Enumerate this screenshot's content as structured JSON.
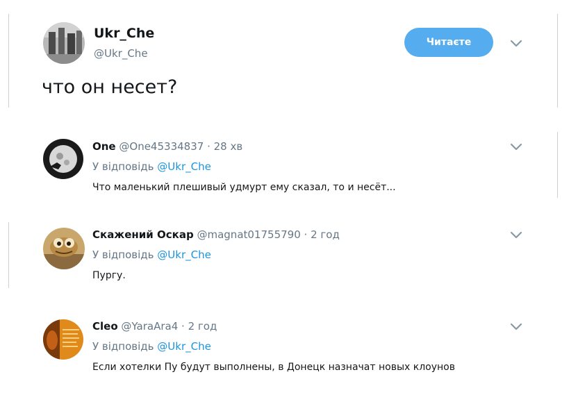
{
  "main_tweet": {
    "name": "Ukr_Che",
    "handle": "@Ukr_Che",
    "follow_label": "Читаєте",
    "text": "что он несет?",
    "chevron_icon": "chevron-down-icon"
  },
  "replies": [
    {
      "name": "One",
      "handle": "@One45334837",
      "sep": "·",
      "time": "28 хв",
      "reply_prefix": "У відповідь",
      "reply_to": "@Ukr_Che",
      "text": "Что маленький плешивый удмурт ему сказал, то и несёт..."
    },
    {
      "name": "Скажений Оскар",
      "handle": "@magnat01755790",
      "sep": "·",
      "time": "2 год",
      "reply_prefix": "У відповідь",
      "reply_to": "@Ukr_Che",
      "text": "Пургу."
    },
    {
      "name": "Cleo",
      "handle": "@YaraAra4",
      "sep": "·",
      "time": "2 год",
      "reply_prefix": "У відповідь",
      "reply_to": "@Ukr_Che",
      "text": "Если хотелки Пу будут выполнены, в Донецк назначат новых клоунов"
    }
  ],
  "colors": {
    "accent": "#55acee",
    "link": "#1b95e0",
    "secondary_text": "#657786",
    "primary_text": "#14171a"
  }
}
